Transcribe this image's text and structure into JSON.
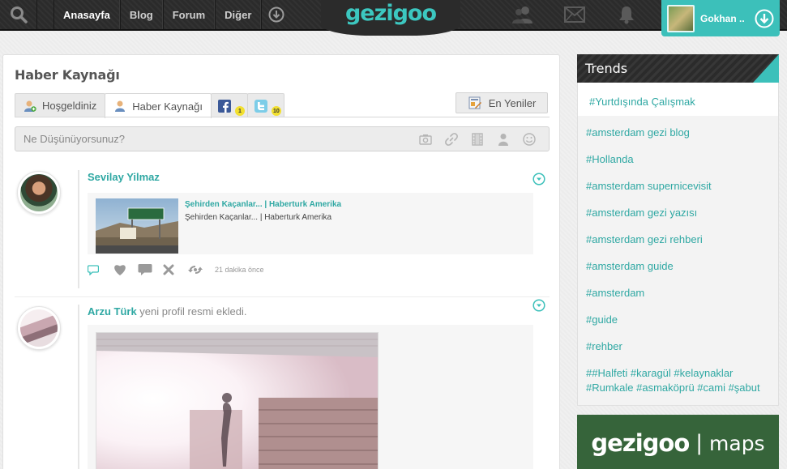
{
  "header": {
    "nav": [
      {
        "label": "Anasayfa"
      },
      {
        "label": "Blog"
      },
      {
        "label": "Forum"
      },
      {
        "label": "Diğer"
      }
    ],
    "logo": "gezigoo",
    "user_name": "Gokhan .."
  },
  "main": {
    "title": "Haber Kaynağı",
    "tabs": [
      {
        "label": "Hoşgeldiniz"
      },
      {
        "label": "Haber Kaynağı"
      },
      {
        "badge": "1"
      },
      {
        "badge": "10"
      }
    ],
    "newest_label": "En Yeniler",
    "composer_placeholder": "Ne Düşünüyorsunuz?"
  },
  "feed": [
    {
      "author": "Sevilay Yilmaz",
      "link_title": "Şehirden Kaçanlar... | Haberturk Amerika",
      "link_desc": "Şehirden Kaçanlar... | Haberturk Amerika",
      "time": "21 dakika önce"
    },
    {
      "author": "Arzu Türk",
      "action": "yeni profil resmi ekledi."
    }
  ],
  "trends": {
    "title": "Trends",
    "items": [
      "#Yurtdışında Çalışmak",
      "#amsterdam gezi blog",
      "#Hollanda",
      "#amsterdam supernicevisit",
      "#amsterdam gezi yazısı",
      "#amsterdam gezi rehberi",
      "#amsterdam guide",
      "#amsterdam",
      "#guide",
      "#rehber",
      "##Halfeti #karagül #kelaynaklar #Rumkale #asmaköprü #cami #şabut"
    ]
  },
  "maps_banner": {
    "brand": "gezigoo",
    "separator": "|",
    "product": "maps"
  },
  "colors": {
    "accent": "#3cc0ba",
    "topbar": "#2b2b2b",
    "maps_bg": "#36643a"
  }
}
